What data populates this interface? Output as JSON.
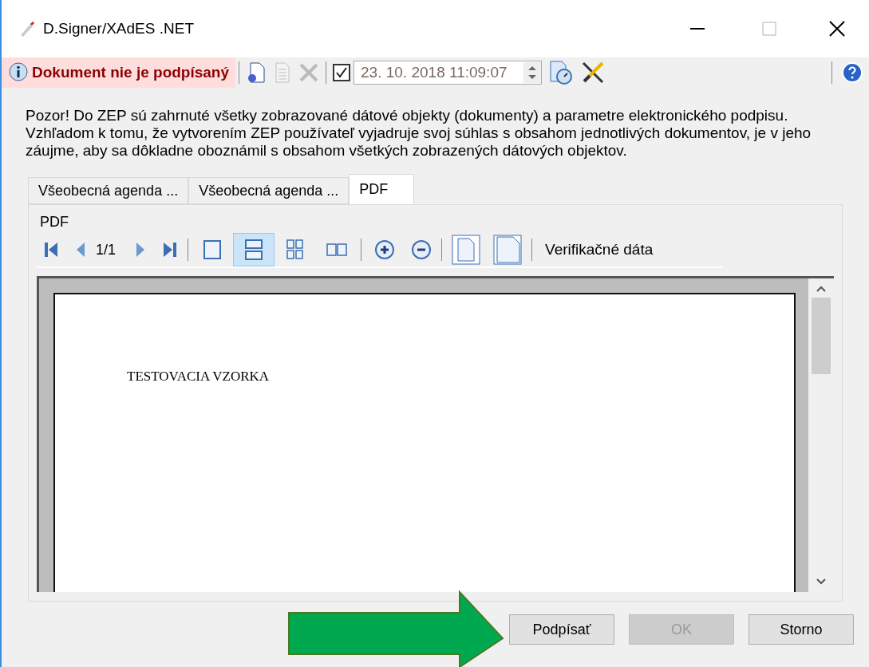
{
  "window": {
    "title": "D.Signer/XAdES .NET"
  },
  "toolbar": {
    "status": "Dokument nie je podpísaný",
    "actions": [
      {
        "kind": "settings-doc",
        "disabled": false
      },
      {
        "kind": "doc",
        "disabled": true
      },
      {
        "kind": "delete",
        "disabled": true
      }
    ],
    "timestamp": {
      "checked": true,
      "value": "23. 10. 2018 11:09:07"
    }
  },
  "notice": "Pozor! Do ZEP sú zahrnuté všetky zobrazované dátové objekty (dokumenty) a parametre elektronického podpisu. Vzhľadom k tomu, že vytvorením ZEP používateľ vyjadruje svoj súhlas s obsahom jednotlivých dokumentov, je v jeho záujme, aby sa dôkladne oboznámil s obsahom všetkých zobrazených dátových objektov.",
  "tabs": [
    {
      "label": "Všeobecná agenda ...",
      "selected": false
    },
    {
      "label": "Všeobecná agenda ...",
      "selected": false
    },
    {
      "label": "PDF",
      "selected": true
    }
  ],
  "pdf": {
    "label": "PDF",
    "page": "1/1",
    "view_modes": [
      {
        "kind": "single",
        "selected": false
      },
      {
        "kind": "continuous",
        "selected": true
      },
      {
        "kind": "grid",
        "selected": false
      },
      {
        "kind": "facing",
        "selected": false
      }
    ],
    "verification": "Verifikačné dáta",
    "document_text": "TESTOVACIA VZORKA"
  },
  "buttons": [
    {
      "label": "Podpísať",
      "disabled": false
    },
    {
      "label": "OK",
      "disabled": true
    },
    {
      "label": "Storno",
      "disabled": false
    }
  ]
}
